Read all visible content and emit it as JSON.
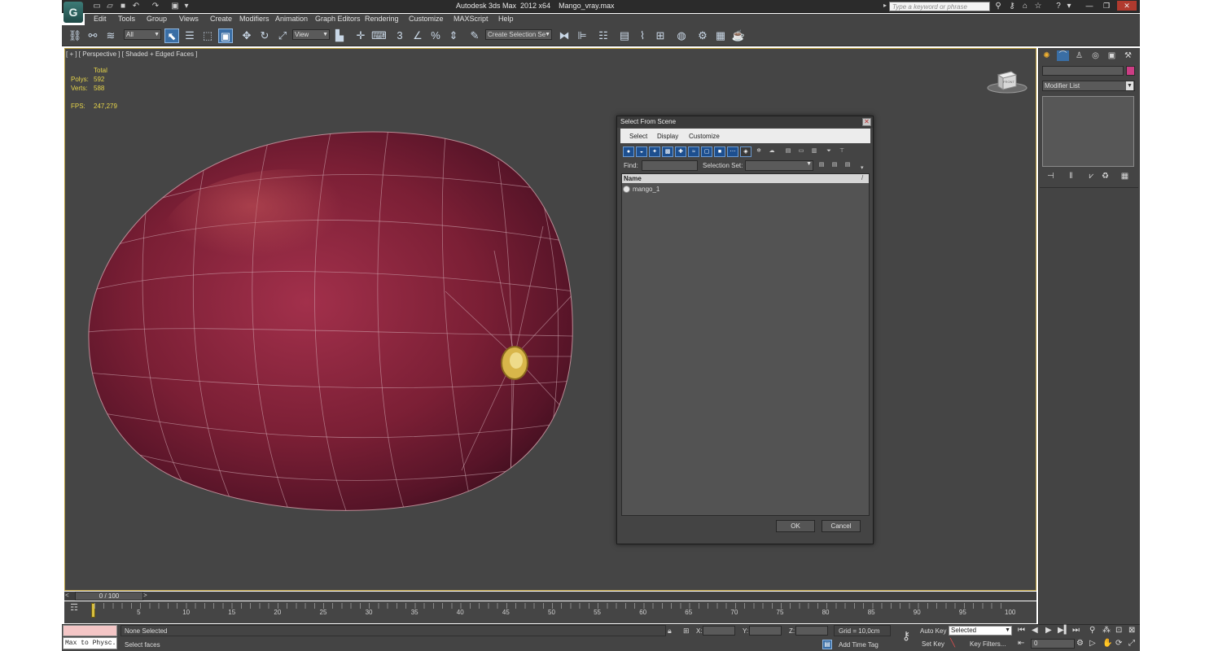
{
  "window": {
    "app_name": "Autodesk 3ds Max  2012 x64",
    "file_name": "Mango_vray.max",
    "search_placeholder": "Type a keyword or phrase",
    "logo_glyph": "G"
  },
  "menu": [
    "Edit",
    "Tools",
    "Group",
    "Views",
    "Create",
    "Modifiers",
    "Animation",
    "Graph Editors",
    "Rendering",
    "Customize",
    "MAXScript",
    "Help"
  ],
  "toolbar": {
    "selection_filter": "All",
    "ref_coord": "View",
    "snap_label": "3",
    "named_selection": "Create Selection Se"
  },
  "viewport": {
    "label": "[ + ] [ Perspective ] [ Shaded + Edged Faces ]",
    "stats": {
      "total_header": "Total",
      "polys_label": "Polys:",
      "polys_value": "592",
      "verts_label": "Verts:",
      "verts_value": "588",
      "fps_label": "FPS:",
      "fps_value": "247,279"
    },
    "viewcube_label": "FRONT"
  },
  "dialog": {
    "title": "Select From Scene",
    "menus": [
      "Select",
      "Display",
      "Customize"
    ],
    "find_label": "Find:",
    "selection_set_label": "Selection Set:",
    "column_header": "Name",
    "items": [
      "mango_1"
    ],
    "ok_label": "OK",
    "cancel_label": "Cancel"
  },
  "command_panel": {
    "modifier_list": "Modifier List"
  },
  "timeline": {
    "frame_counter": "0 / 100",
    "ticks": [
      "5",
      "10",
      "15",
      "20",
      "25",
      "30",
      "35",
      "40",
      "45",
      "50",
      "55",
      "60",
      "65",
      "70",
      "75",
      "80",
      "85",
      "90",
      "95",
      "100"
    ]
  },
  "status": {
    "maxscript_text": "Max to Physc.",
    "selection_status": "None Selected",
    "prompt": "Select faces",
    "x_label": "X:",
    "y_label": "Y:",
    "z_label": "Z:",
    "grid": "Grid = 10,0cm",
    "add_time_tag": "Add Time Tag",
    "auto_key": "Auto Key",
    "set_key": "Set Key",
    "key_mode": "Selected",
    "key_filters": "Key Filters...",
    "current_frame": "0"
  }
}
